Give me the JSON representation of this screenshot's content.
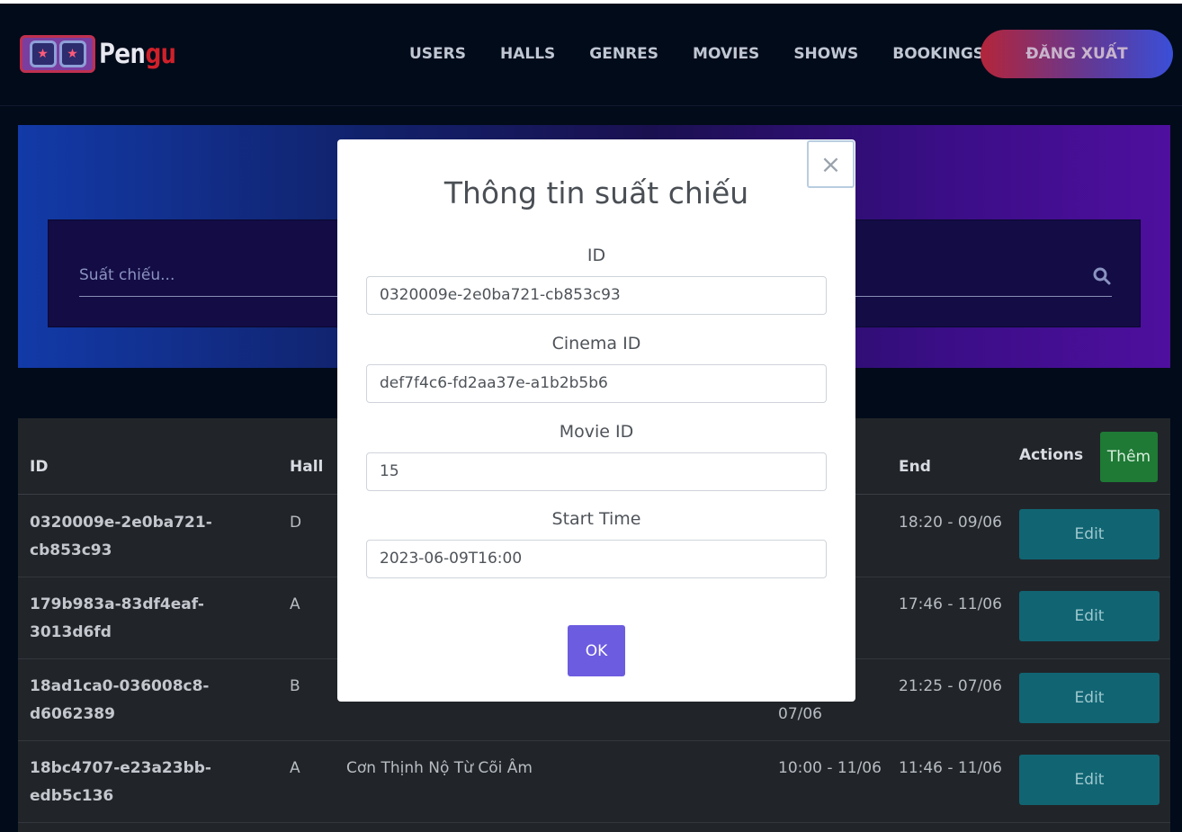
{
  "logo": {
    "text_main": "Pen",
    "text_accent": "gu",
    "reel_symbol": "★"
  },
  "nav": {
    "items": [
      "USERS",
      "HALLS",
      "GENRES",
      "MOVIES",
      "SHOWS",
      "BOOKINGS"
    ],
    "logout_label": "ĐĂNG XUẤT"
  },
  "search": {
    "placeholder": "Suất chiếu..."
  },
  "table": {
    "headers": {
      "id": "ID",
      "hall": "Hall",
      "end": "End",
      "actions": "Actions"
    },
    "add_label": "Thêm",
    "edit_label": "Edit",
    "rows": [
      {
        "id": "0320009e-2e0ba721-cb853c93",
        "hall": "D",
        "movie": "",
        "start": "",
        "end": "18:20 - 09/06"
      },
      {
        "id": "179b983a-83df4eaf-3013d6fd",
        "hall": "A",
        "movie": "",
        "start": "",
        "end": "17:46 - 11/06"
      },
      {
        "id": "18ad1ca0-036008c8-d6062389",
        "hall": "B",
        "movie": "",
        "start": "07/06",
        "end": "21:25 - 07/06"
      },
      {
        "id": "18bc4707-e23a23bb-edb5c136",
        "hall": "A",
        "movie": "Cơn Thịnh Nộ Từ Cõi Âm",
        "start": "10:00 - 11/06",
        "end": "11:46 - 11/06"
      }
    ]
  },
  "modal": {
    "title": "Thông tin suất chiếu",
    "close_symbol": "×",
    "fields": [
      {
        "label": "ID",
        "value": "0320009e-2e0ba721-cb853c93"
      },
      {
        "label": "Cinema ID",
        "value": "def7f4c6-fd2aa37e-a1b2b5b6"
      },
      {
        "label": "Movie ID",
        "value": "15"
      },
      {
        "label": "Start Time",
        "value": "2023-06-09T16:00"
      }
    ],
    "ok_label": "OK"
  },
  "colors": {
    "background": "#010b1a",
    "add_button": "#1e7a35",
    "edit_button": "#116573",
    "ok_button": "#6c5ce0",
    "brand_accent": "#d0202a"
  }
}
